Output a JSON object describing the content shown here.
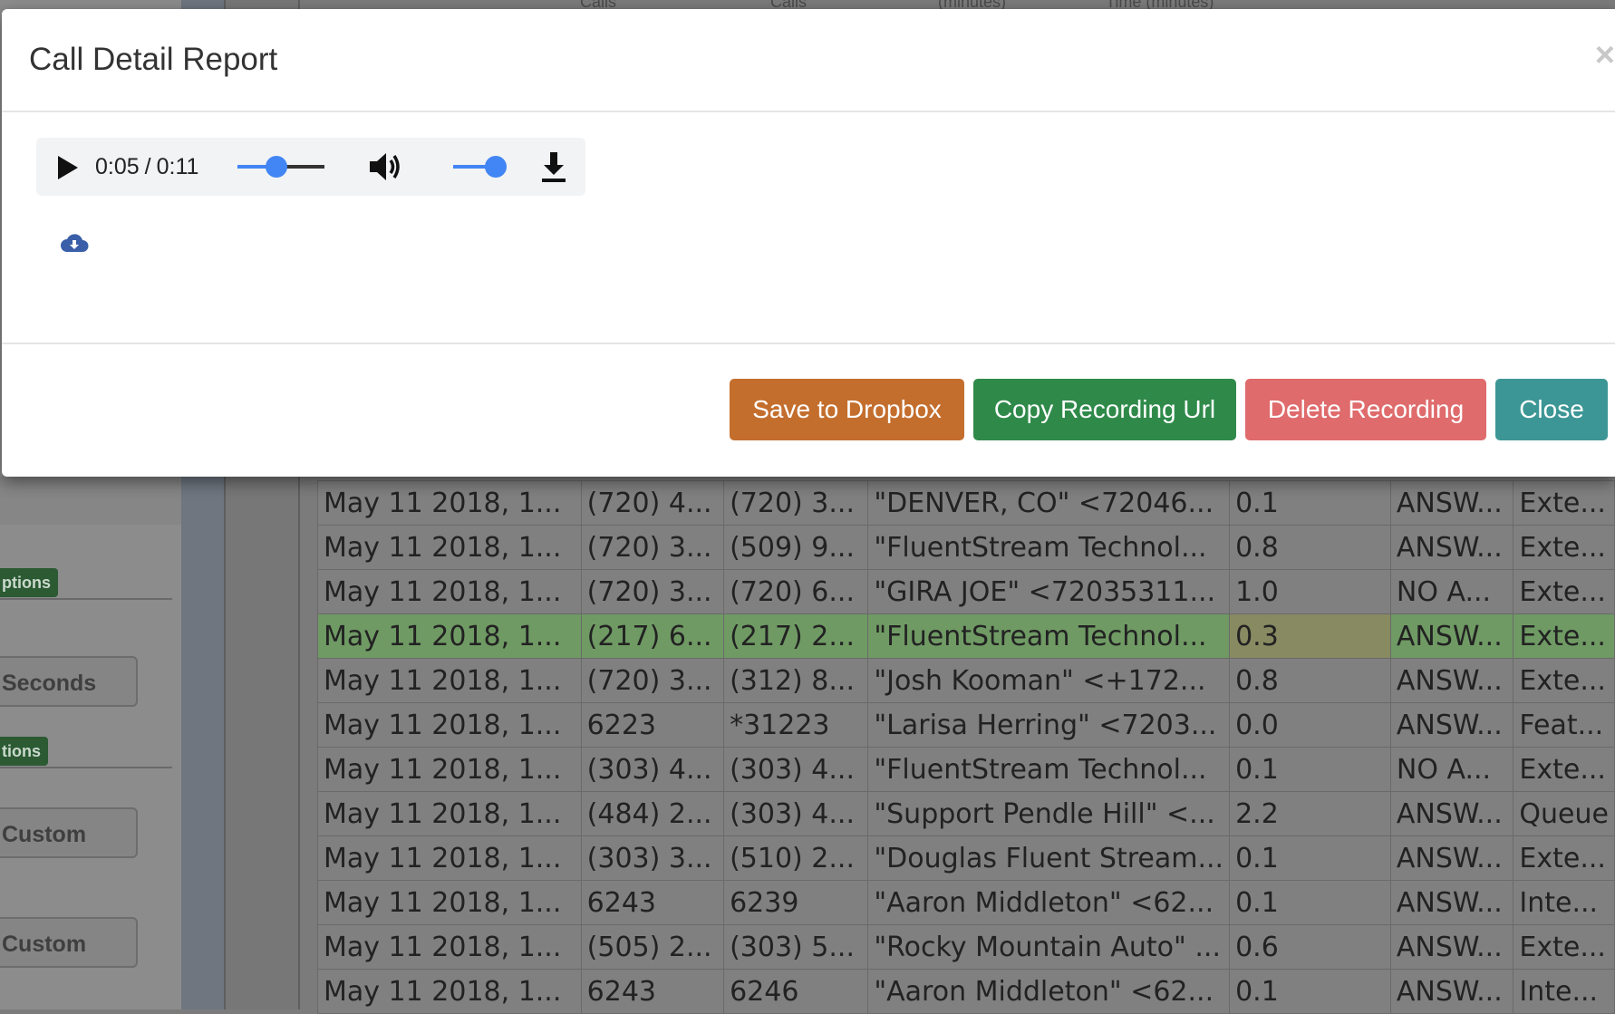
{
  "modal": {
    "title": "Call Detail Report",
    "close_glyph": "×",
    "player": {
      "current_time": "0:05",
      "duration": "0:11",
      "progress_fraction": 0.45,
      "volume_fraction": 1.0
    },
    "buttons": {
      "save_dropbox": "Save to Dropbox",
      "copy_url": "Copy Recording Url",
      "delete": "Delete Recording",
      "close": "Close"
    }
  },
  "background": {
    "header_labels": [
      "Calls",
      "Calls",
      "(minutes)",
      "Time (minutes)"
    ],
    "sidebar": {
      "badge_1": "ptions",
      "badge_2": "tions",
      "button_seconds": "Seconds",
      "button_custom_1": "Custom",
      "button_custom_2": "Custom"
    },
    "rows": [
      {
        "date": "May 11 2018, 1...",
        "from": "(720) 4...",
        "to": "(720) 3...",
        "caller": "\"DENVER, CO\" <72046...",
        "min": "0.1",
        "status": "ANSW...",
        "type": "Exte..."
      },
      {
        "date": "May 11 2018, 1...",
        "from": "(720) 3...",
        "to": "(509) 9...",
        "caller": "\"FluentStream Technol...",
        "min": "0.8",
        "status": "ANSW...",
        "type": "Exte..."
      },
      {
        "date": "May 11 2018, 1...",
        "from": "(720) 3...",
        "to": "(720) 6...",
        "caller": "\"GIRA JOE\" <72035311...",
        "min": "1.0",
        "status": "NO A...",
        "type": "Exte..."
      },
      {
        "date": "May 11 2018, 1...",
        "from": "(217) 6...",
        "to": "(217) 2...",
        "caller": "\"FluentStream Technol...",
        "min": "0.3",
        "status": "ANSW...",
        "type": "Exte...",
        "highlight": true
      },
      {
        "date": "May 11 2018, 1...",
        "from": "(720) 3...",
        "to": "(312) 8...",
        "caller": "\"Josh Kooman\" <+172...",
        "min": "0.8",
        "status": "ANSW...",
        "type": "Exte..."
      },
      {
        "date": "May 11 2018, 1...",
        "from": "6223",
        "to": "*31223",
        "caller": "\"Larisa Herring\" <7203...",
        "min": "0.0",
        "status": "ANSW...",
        "type": "Feat..."
      },
      {
        "date": "May 11 2018, 1...",
        "from": "(303) 4...",
        "to": "(303) 4...",
        "caller": "\"FluentStream Technol...",
        "min": "0.1",
        "status": "NO A...",
        "type": "Exte..."
      },
      {
        "date": "May 11 2018, 1...",
        "from": "(484) 2...",
        "to": "(303) 4...",
        "caller": "\"Support Pendle Hill\" <...",
        "min": "2.2",
        "status": "ANSW...",
        "type": "Queue"
      },
      {
        "date": "May 11 2018, 1...",
        "from": "(303) 3...",
        "to": "(510) 2...",
        "caller": "\"Douglas Fluent Stream...",
        "min": "0.1",
        "status": "ANSW...",
        "type": "Exte..."
      },
      {
        "date": "May 11 2018, 1...",
        "from": "6243",
        "to": "6239",
        "caller": "\"Aaron Middleton\" <62...",
        "min": "0.1",
        "status": "ANSW...",
        "type": "Inte..."
      },
      {
        "date": "May 11 2018, 1...",
        "from": "(505) 2...",
        "to": "(303) 5...",
        "caller": "\"Rocky Mountain Auto\" ...",
        "min": "0.6",
        "status": "ANSW...",
        "type": "Exte..."
      },
      {
        "date": "May 11 2018, 1...",
        "from": "6243",
        "to": "6246",
        "caller": "\"Aaron Middleton\" <62...",
        "min": "0.1",
        "status": "ANSW...",
        "type": "Inte..."
      }
    ]
  },
  "colors": {
    "dropbox": "#c46e2e",
    "copy": "#2f8a4a",
    "delete": "#df6b6c",
    "close": "#3d9696",
    "accent": "#4285f4"
  }
}
